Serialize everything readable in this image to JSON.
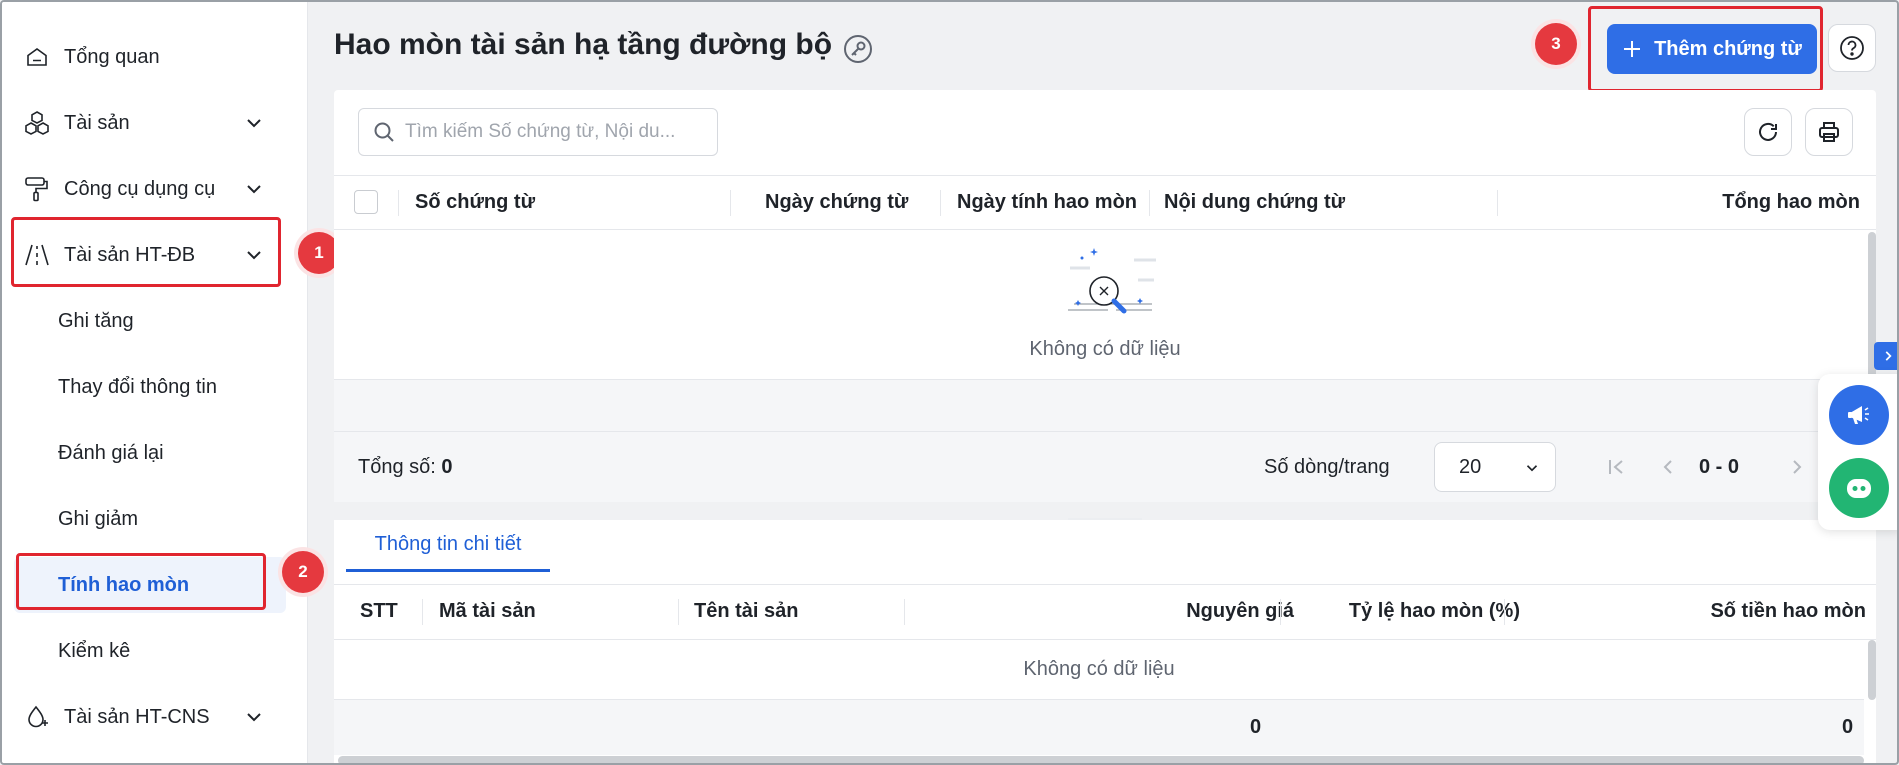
{
  "sidebar": {
    "items": [
      {
        "label": "Tổng quan",
        "icon": "home-icon"
      },
      {
        "label": "Tài sản",
        "icon": "cubes-icon"
      },
      {
        "label": "Công cụ dụng cụ",
        "icon": "paint-roller-icon"
      },
      {
        "label": "Tài sản HT-ĐB",
        "icon": "road-icon"
      }
    ],
    "sub_items": [
      "Ghi tăng",
      "Thay đổi thông tin",
      "Đánh giá lại",
      "Ghi giảm",
      "Tính hao mòn",
      "Kiểm kê"
    ],
    "bottom_item": {
      "label": "Tài sản HT-CNS",
      "icon": "water-drop-icon"
    }
  },
  "annotations": [
    "1",
    "2",
    "3"
  ],
  "header": {
    "title": "Hao mòn tài sản hạ tầng đường bộ",
    "add_button": "Thêm chứng từ"
  },
  "search": {
    "placeholder": "Tìm kiếm Số chứng từ, Nội du..."
  },
  "table": {
    "columns": [
      "Số chứng từ",
      "Ngày chứng từ",
      "Ngày tính hao mòn",
      "Nội dung chứng từ",
      "Tổng hao mòn"
    ],
    "empty_text": "Không có dữ liệu"
  },
  "footer": {
    "total_label": "Tổng số:",
    "total_value": "0",
    "rows_label": "Số dòng/trang",
    "page_size": "20",
    "range": "0 - 0"
  },
  "detail": {
    "tab": "Thông tin chi tiết",
    "columns": [
      "STT",
      "Mã tài sản",
      "Tên tài sản",
      "Nguyên giá",
      "Tỷ lệ hao mòn (%)",
      "Số tiền hao mòn"
    ],
    "empty_text": "Không có dữ liệu",
    "sum_original": "0",
    "sum_depreciation": "0"
  },
  "colors": {
    "accent": "#2f6ee6",
    "annotation_red": "#e0252f",
    "chat_green": "#22b573"
  }
}
